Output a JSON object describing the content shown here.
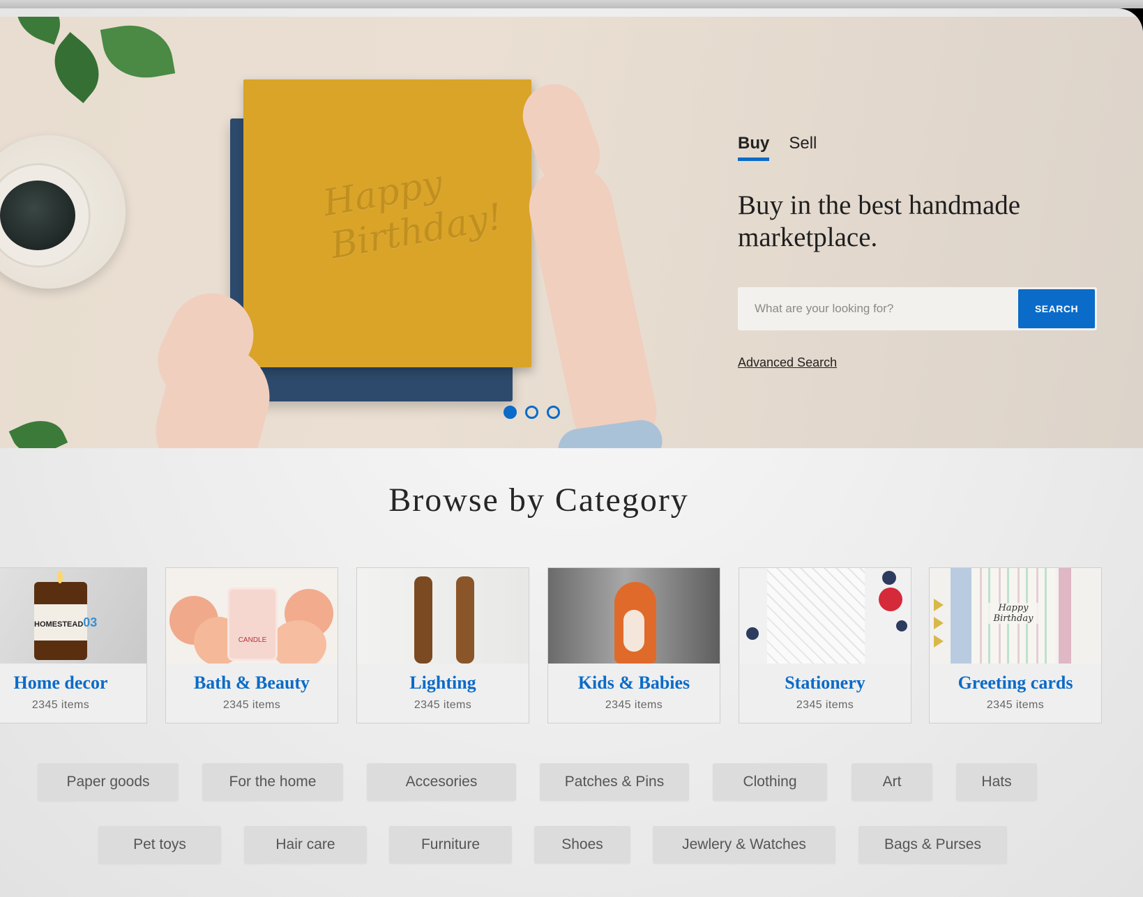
{
  "hero": {
    "card_text": "Happy Birthday!",
    "tabs": [
      {
        "label": "Buy",
        "active": true
      },
      {
        "label": "Sell",
        "active": false
      }
    ],
    "title": "Buy in the best handmade marketplace.",
    "search": {
      "placeholder": "What are your looking for?",
      "value": "",
      "button_label": "SEARCH"
    },
    "advanced_search": "Advanced Search",
    "carousel": {
      "slides": 3,
      "active": 1
    }
  },
  "browse": {
    "title": "Browse by Category",
    "categories": [
      {
        "name": "Home decor",
        "count": "2345 items"
      },
      {
        "name": "Bath & Beauty",
        "count": "2345 items"
      },
      {
        "name": "Lighting",
        "count": "2345 items"
      },
      {
        "name": "Kids & Babies",
        "count": "2345 items"
      },
      {
        "name": "Stationery",
        "count": "2345 items"
      },
      {
        "name": "Greeting cards",
        "count": "2345 items"
      }
    ],
    "image_labels": {
      "homestead": "HOMESTEAD",
      "homestead_number": "03",
      "candle": "CANDLE",
      "greeting_card": "Happy Birthday"
    },
    "tags_row1": [
      "Paper goods",
      "For the home",
      "Accesories",
      "Patches & Pins",
      "Clothing",
      "Art",
      "Hats"
    ],
    "tags_row2": [
      "Pet toys",
      "Hair care",
      "Furniture",
      "Shoes",
      "Jewlery & Watches",
      "Bags & Purses"
    ]
  },
  "colors": {
    "accent": "#0b6bc8",
    "card_yellow": "#d9a428",
    "notebook_navy": "#2d4a6c",
    "chip_bg": "#dcdcdc"
  }
}
